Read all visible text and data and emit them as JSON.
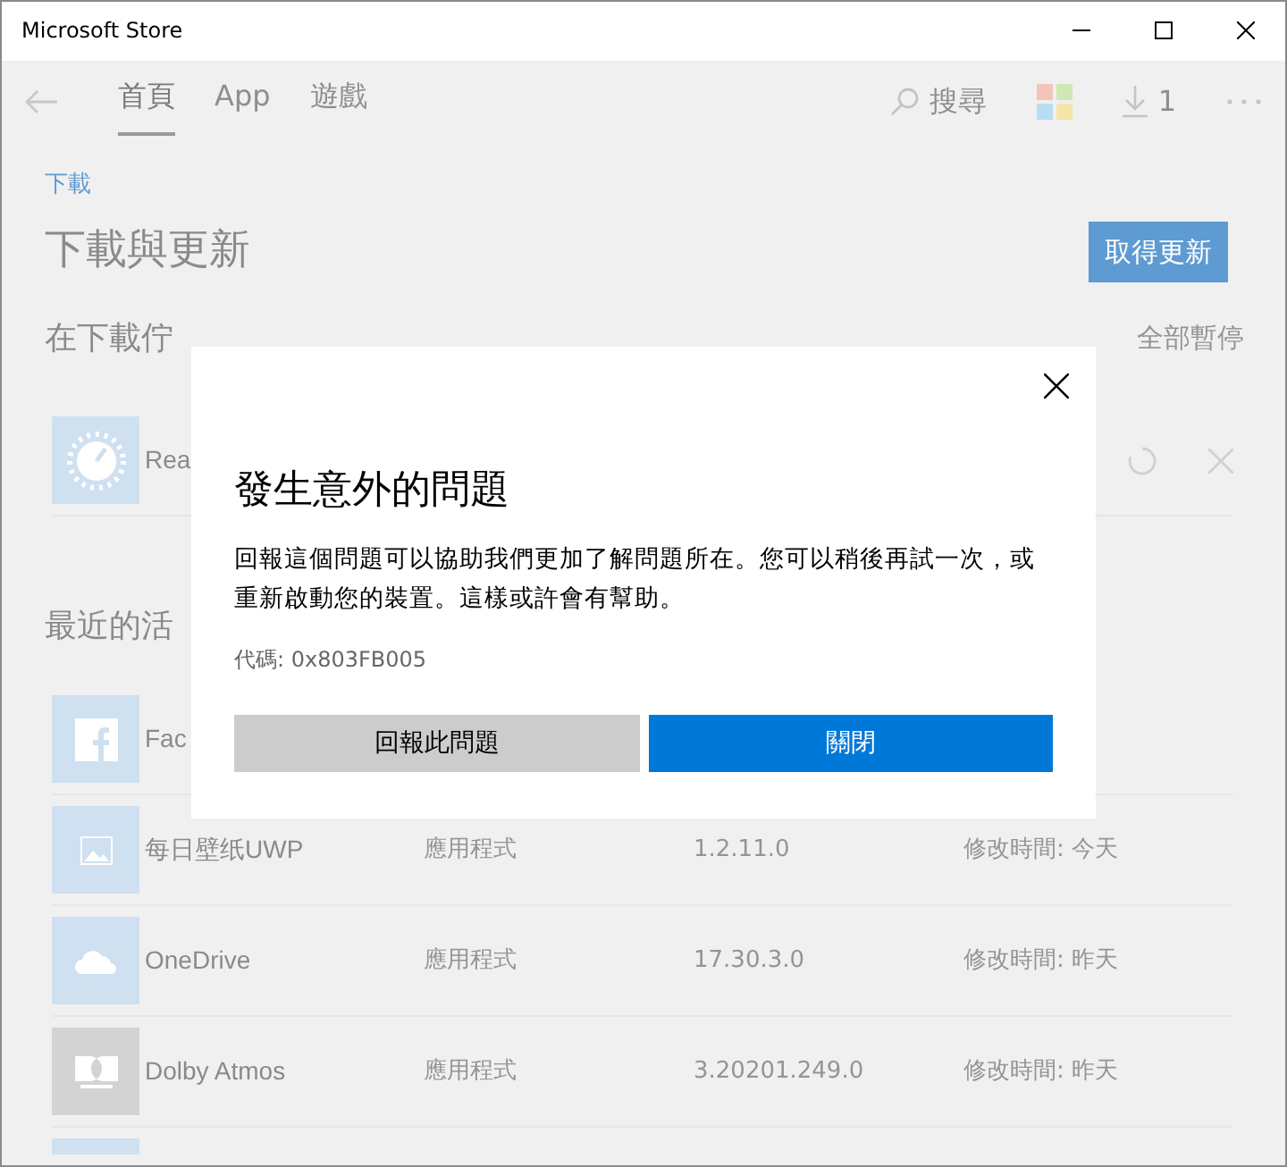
{
  "window": {
    "title": "Microsoft Store"
  },
  "nav": {
    "tabs": [
      {
        "label": "首頁",
        "selected": true
      },
      {
        "label": "App",
        "selected": false
      },
      {
        "label": "遊戲",
        "selected": false
      }
    ],
    "search_label": "搜尋",
    "downloads_count": "1"
  },
  "breadcrumb": "下載",
  "heading": "下載與更新",
  "get_updates_button": "取得更新",
  "queue": {
    "heading": "在下載佇",
    "pause_all": "全部暫停",
    "items": [
      {
        "name": "Rea",
        "color": "#cfe0f1"
      }
    ]
  },
  "recent": {
    "heading": "最近的活",
    "items": [
      {
        "name": "Fac",
        "color": "#cfe0f1"
      },
      {
        "name": "每日壁纸UWP",
        "type": "應用程式",
        "version": "1.2.11.0",
        "modified": "修改時間: 今天",
        "color": "#cfe0f1"
      },
      {
        "name": "OneDrive",
        "type": "應用程式",
        "version": "17.30.3.0",
        "modified": "修改時間: 昨天",
        "color": "#cfe0f1"
      },
      {
        "name": "Dolby Atmos",
        "type": "應用程式",
        "version": "3.20201.249.0",
        "modified": "修改時間: 昨天",
        "color": "#d3d3d3"
      },
      {
        "color": "#cfe0f1"
      }
    ]
  },
  "dialog": {
    "title": "發生意外的問題",
    "message": "回報這個問題可以協助我們更加了解問題所在。您可以稍後再試一次，或重新啟動您的裝置。這樣或許會有幫助。",
    "code": "代碼: 0x803FB005",
    "buttons": [
      {
        "label": "回報此問題",
        "kind": "secondary"
      },
      {
        "label": "關閉",
        "kind": "primary"
      }
    ]
  }
}
